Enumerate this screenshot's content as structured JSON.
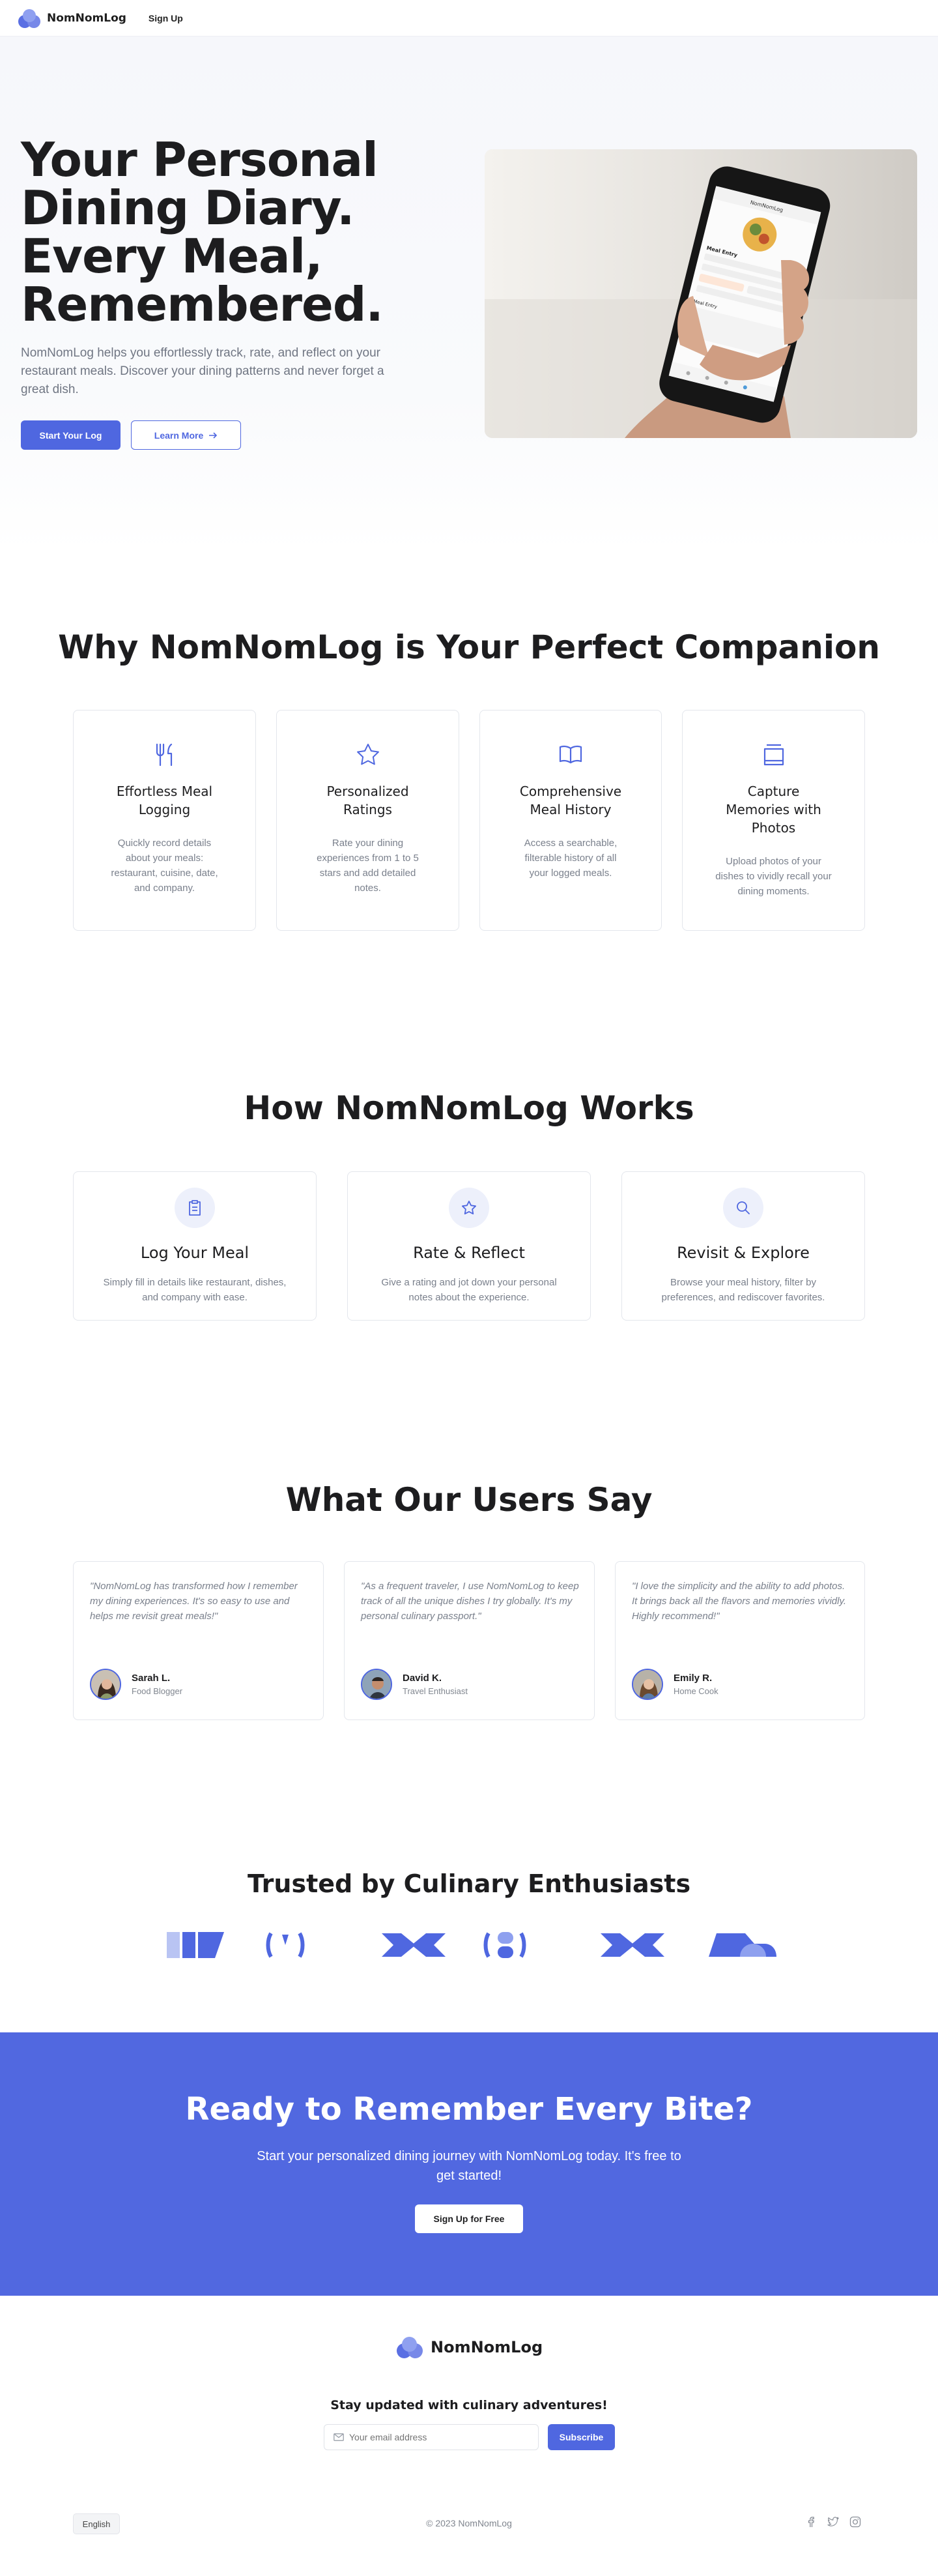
{
  "nav": {
    "brand": "NomNomLog",
    "signup": "Sign Up"
  },
  "hero": {
    "title": "Your Personal Dining Diary. Every Meal, Remembered.",
    "subtitle": "NomNomLog helps you effortlessly track, rate, and reflect on your restaurant meals. Discover your dining patterns and never forget a great dish.",
    "primary_cta": "Start Your Log",
    "secondary_cta": "Learn More",
    "phone": {
      "header": "NomNomLog",
      "section": "Meal Entry",
      "section2": "Meal Entry"
    }
  },
  "features": {
    "title": "Why NomNomLog is Your Perfect Companion",
    "items": [
      {
        "icon": "utensils-icon",
        "title": "Effortless Meal Logging",
        "text": "Quickly record details about your meals: restaurant, cuisine, date, and company."
      },
      {
        "icon": "star-icon",
        "title": "Personalized Ratings",
        "text": "Rate your dining experiences from 1 to 5 stars and add detailed notes."
      },
      {
        "icon": "book-icon",
        "title": "Comprehensive Meal History",
        "text": "Access a searchable, filterable history of all your logged meals."
      },
      {
        "icon": "gallery-icon",
        "title": "Capture Memories with Photos",
        "text": "Upload photos of your dishes to vividly recall your dining moments."
      }
    ]
  },
  "how": {
    "title": "How NomNomLog Works",
    "steps": [
      {
        "icon": "clipboard-icon",
        "title": "Log Your Meal",
        "text": "Simply fill in details like restaurant, dishes, and company with ease."
      },
      {
        "icon": "star-icon",
        "title": "Rate & Reflect",
        "text": "Give a rating and jot down your personal notes about the experience."
      },
      {
        "icon": "search-icon",
        "title": "Revisit & Explore",
        "text": "Browse your meal history, filter by preferences, and rediscover favorites."
      }
    ]
  },
  "testimonials": {
    "title": "What Our Users Say",
    "items": [
      {
        "quote": "\"NomNomLog has transformed how I remember my dining experiences. It's so easy to use and helps me revisit great meals!\"",
        "name": "Sarah L.",
        "role": "Food Blogger"
      },
      {
        "quote": "\"As a frequent traveler, I use NomNomLog to keep track of all the unique dishes I try globally. It's my personal culinary passport.\"",
        "name": "David K.",
        "role": "Travel Enthusiast"
      },
      {
        "quote": "\"I love the simplicity and the ability to add photos. It brings back all the flavors and memories vividly. Highly recommend!\"",
        "name": "Emily R.",
        "role": "Home Cook"
      }
    ]
  },
  "trusted": {
    "title": "Trusted by Culinary Enthusiasts"
  },
  "cta": {
    "title": "Ready to Remember Every Bite?",
    "text": "Start your personalized dining journey with NomNomLog today. It's free to get started!",
    "button": "Sign Up for Free"
  },
  "footer": {
    "brand": "NomNomLog",
    "newsletter_title": "Stay updated with culinary adventures!",
    "email_placeholder": "Your email address",
    "subscribe": "Subscribe",
    "language": "English",
    "copyright": "© 2023 NomNomLog"
  },
  "colors": {
    "accent": "#4f67e0",
    "cta_bg": "#5168e0",
    "text": "#1d1d1f",
    "muted": "#7a808c"
  }
}
